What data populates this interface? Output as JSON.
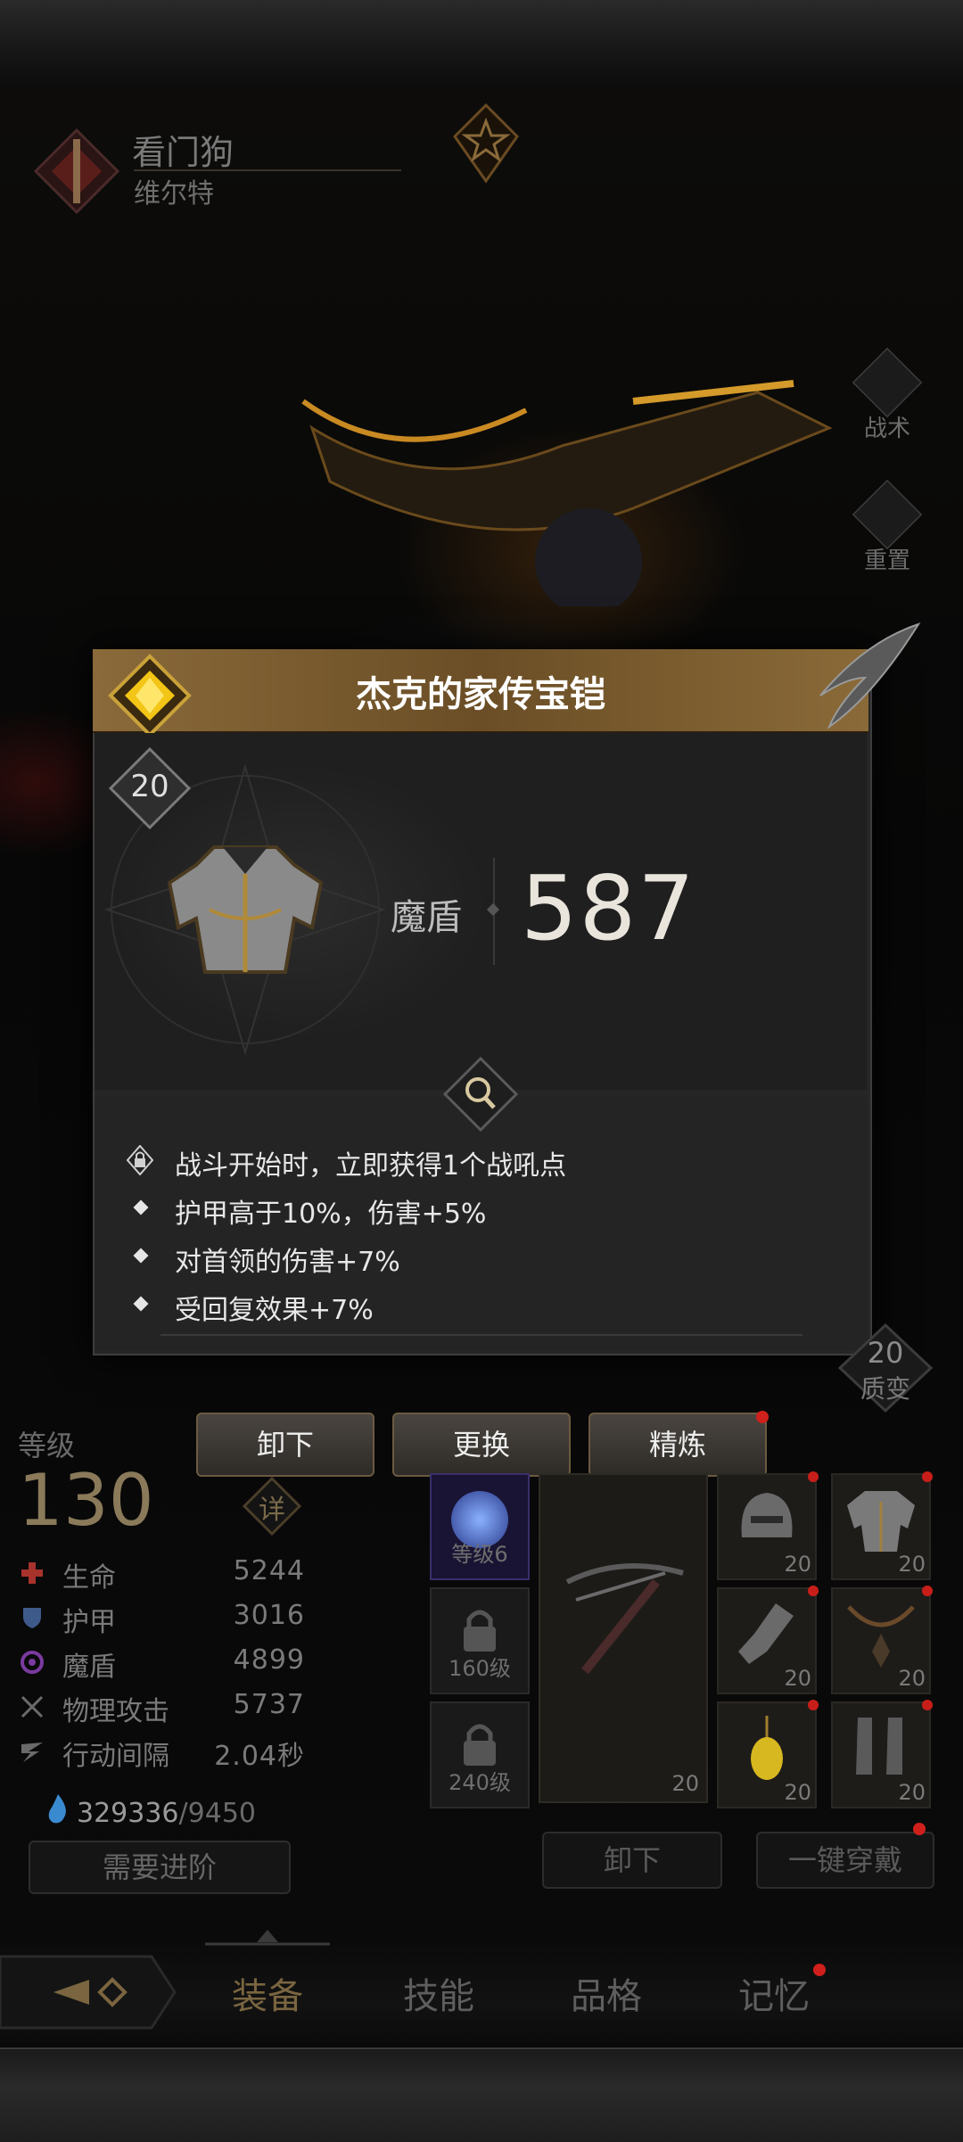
{
  "header": {
    "name": "看门狗",
    "subtitle": "维尔特"
  },
  "side_buttons": [
    {
      "label": "战术",
      "icon": "tactics-icon"
    },
    {
      "label": "重置",
      "icon": "reset-icon"
    }
  ],
  "item_popup": {
    "title": "杰克的家传宝铠",
    "level": "20",
    "stat_label": "魔盾",
    "stat_value": "587",
    "effects": [
      {
        "text": "战斗开始时，立即获得1个战吼点",
        "icon": "lock-icon"
      },
      {
        "text": "护甲高于10%，伤害+5%",
        "icon": "diamond-bullet-icon"
      },
      {
        "text": "对首领的伤害+7%",
        "icon": "diamond-bullet-icon"
      },
      {
        "text": "受回复效果+7%",
        "icon": "diamond-bullet-icon"
      }
    ]
  },
  "transmute": {
    "value": "20",
    "label": "质变"
  },
  "actions": {
    "unequip": "卸下",
    "replace": "更换",
    "refine": "精炼"
  },
  "character": {
    "level_label": "等级",
    "level": "130",
    "detail_label": "详",
    "stats": [
      {
        "name": "生命",
        "value": "5244",
        "icon": "health-cross-icon",
        "color": "#a8322c"
      },
      {
        "name": "护甲",
        "value": "3016",
        "icon": "shield-icon",
        "color": "#3d5a8a"
      },
      {
        "name": "魔盾",
        "value": "4899",
        "icon": "magic-swirl-icon",
        "color": "#7a3aa0"
      },
      {
        "name": "物理攻击",
        "value": "5737",
        "icon": "crossed-swords-icon",
        "color": "#6a6a6a"
      },
      {
        "name": "行动间隔",
        "value": "2.04秒",
        "icon": "speed-wing-icon",
        "color": "#6a6a6a"
      }
    ],
    "souls": "329336",
    "souls_required": "/9450",
    "advance_label": "需要进阶"
  },
  "equipment": {
    "gem_slots": [
      {
        "text": "等级6"
      },
      {
        "text": "160级"
      },
      {
        "text": "240级"
      }
    ],
    "weapon_level": "20",
    "armor_slots": [
      {
        "level": "20",
        "icon": "helmet-icon"
      },
      {
        "level": "20",
        "icon": "chestplate-icon"
      },
      {
        "level": "20",
        "icon": "gauntlet-icon"
      },
      {
        "level": "20",
        "icon": "necklace-icon"
      },
      {
        "level": "20",
        "icon": "amulet-icon"
      },
      {
        "level": "20",
        "icon": "boots-icon"
      }
    ],
    "unequip_label": "卸下",
    "equip_all_label": "一键穿戴"
  },
  "tabs": [
    {
      "label": "装备",
      "active": true
    },
    {
      "label": "技能",
      "active": false
    },
    {
      "label": "品格",
      "active": false
    },
    {
      "label": "记忆",
      "active": false
    }
  ]
}
